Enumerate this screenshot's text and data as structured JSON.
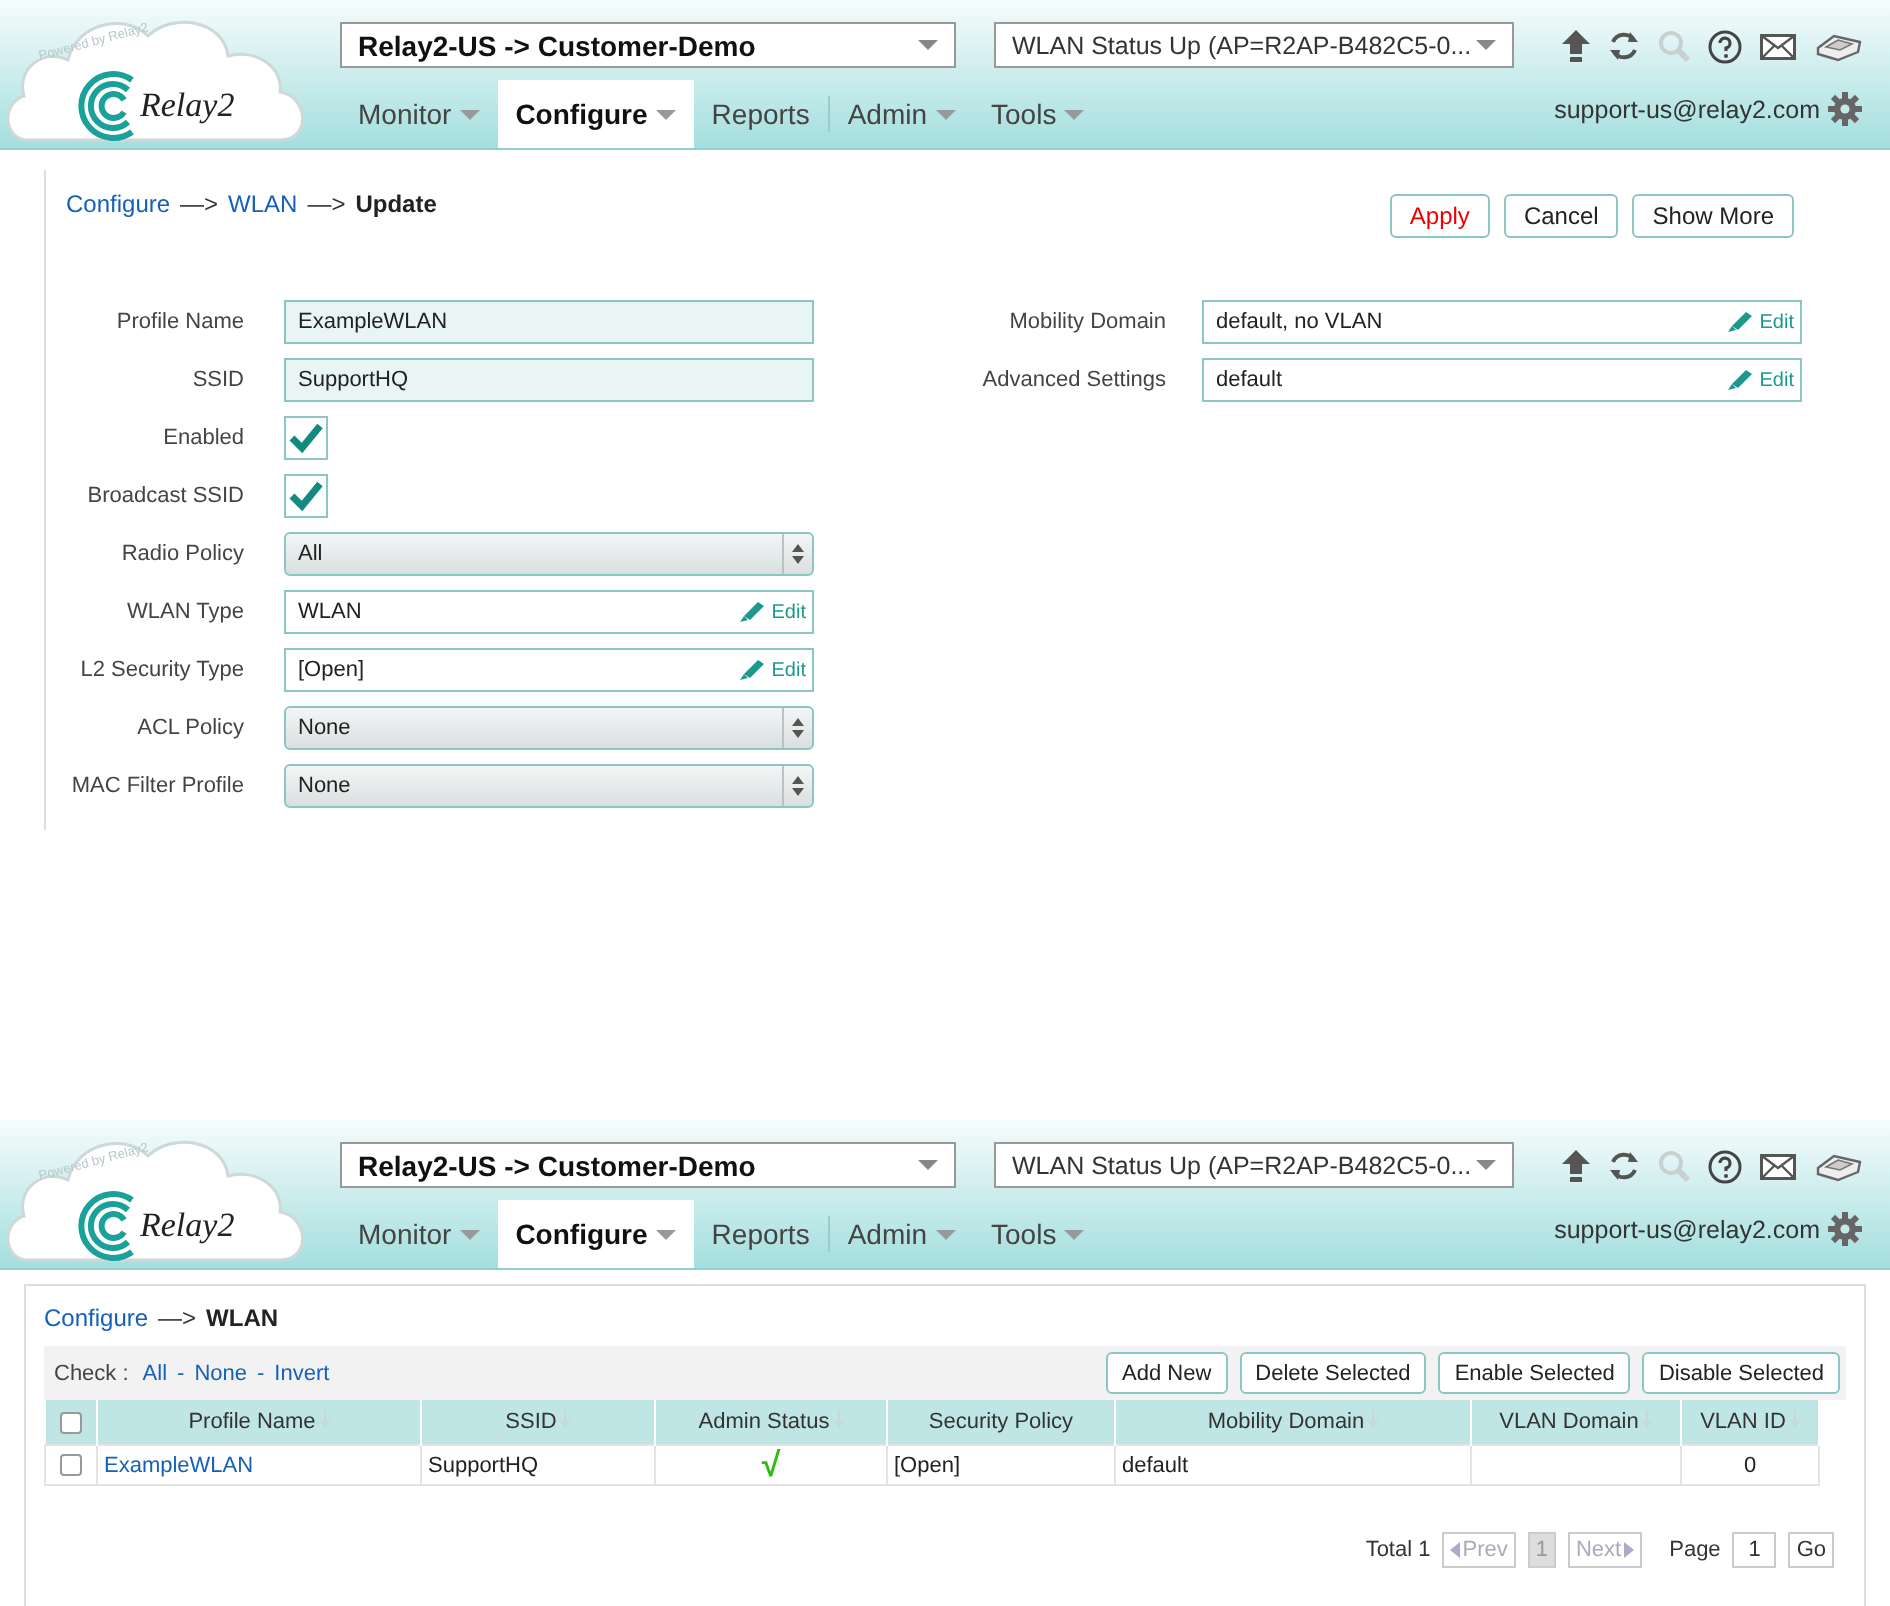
{
  "screens": [
    {
      "kind": "form",
      "header": {
        "logo_text": "Relay2",
        "logo_tagline": "Powered by Relay2",
        "org_select": "Relay2-US -> Customer-Demo",
        "status_select": "WLAN Status Up (AP=R2AP-B482C5-0...",
        "user": "support-us@relay2.com",
        "nav": [
          {
            "label": "Monitor",
            "selected": false,
            "dropdown": true
          },
          {
            "label": "Configure",
            "selected": true,
            "dropdown": true
          },
          {
            "label": "Reports",
            "selected": false,
            "dropdown": false
          },
          {
            "label": "Admin",
            "selected": false,
            "dropdown": true
          },
          {
            "label": "Tools",
            "selected": false,
            "dropdown": true
          }
        ]
      },
      "breadcrumb": {
        "separator": "—>",
        "items": [
          {
            "label": "Configure",
            "link": true
          },
          {
            "label": "WLAN",
            "link": true
          },
          {
            "label": "Update",
            "link": false
          }
        ]
      },
      "buttons": [
        {
          "label": "Apply",
          "kind": "primary"
        },
        {
          "label": "Cancel",
          "kind": "normal"
        },
        {
          "label": "Show More",
          "kind": "normal"
        }
      ],
      "left_fields": [
        {
          "label": "Profile Name",
          "kind": "readonly",
          "value": "ExampleWLAN"
        },
        {
          "label": "SSID",
          "kind": "readonly",
          "value": "SupportHQ"
        },
        {
          "label": "Enabled",
          "kind": "checkbox",
          "checked": true
        },
        {
          "label": "Broadcast SSID",
          "kind": "checkbox",
          "checked": true
        },
        {
          "label": "Radio Policy",
          "kind": "select",
          "value": "All"
        },
        {
          "label": "WLAN Type",
          "kind": "edit",
          "value": "WLAN",
          "edit_label": "Edit"
        },
        {
          "label": "L2 Security Type",
          "kind": "edit",
          "value": "[Open]",
          "edit_label": "Edit"
        },
        {
          "label": "ACL Policy",
          "kind": "select",
          "value": "None"
        },
        {
          "label": "MAC Filter Profile",
          "kind": "select",
          "value": "None"
        }
      ],
      "right_fields": [
        {
          "label": "Mobility Domain",
          "kind": "edit",
          "value": "default, no VLAN",
          "edit_label": "Edit"
        },
        {
          "label": "Advanced Settings",
          "kind": "edit",
          "value": "default",
          "edit_label": "Edit"
        }
      ]
    },
    {
      "kind": "list",
      "header": {
        "logo_text": "Relay2",
        "logo_tagline": "Powered by Relay2",
        "org_select": "Relay2-US -> Customer-Demo",
        "status_select": "WLAN Status Up (AP=R2AP-B482C5-0...",
        "user": "support-us@relay2.com",
        "nav": [
          {
            "label": "Monitor",
            "selected": false,
            "dropdown": true
          },
          {
            "label": "Configure",
            "selected": true,
            "dropdown": true
          },
          {
            "label": "Reports",
            "selected": false,
            "dropdown": false
          },
          {
            "label": "Admin",
            "selected": false,
            "dropdown": true
          },
          {
            "label": "Tools",
            "selected": false,
            "dropdown": true
          }
        ]
      },
      "breadcrumb": {
        "separator": "—>",
        "items": [
          {
            "label": "Configure",
            "link": true
          },
          {
            "label": "WLAN",
            "link": false
          }
        ]
      },
      "check": {
        "label": "Check :",
        "separator": "-",
        "links": [
          "All",
          "None",
          "Invert"
        ]
      },
      "buttons": [
        {
          "label": "Add New",
          "kind": "normal"
        },
        {
          "label": "Delete Selected",
          "kind": "normal"
        },
        {
          "label": "Enable Selected",
          "kind": "normal"
        },
        {
          "label": "Disable Selected",
          "kind": "normal"
        }
      ],
      "table": {
        "select_all_checked": false,
        "columns": [
          {
            "label": "Profile Name",
            "sortable": true
          },
          {
            "label": "SSID",
            "sortable": true
          },
          {
            "label": "Admin Status",
            "sortable": true
          },
          {
            "label": "Security Policy",
            "sortable": false
          },
          {
            "label": "Mobility Domain",
            "sortable": true
          },
          {
            "label": "VLAN Domain",
            "sortable": true
          },
          {
            "label": "VLAN ID",
            "sortable": true
          }
        ],
        "rows": [
          {
            "checked": false,
            "cells": [
              "ExampleWLAN",
              "SupportHQ",
              "√",
              "[Open]",
              "default",
              "",
              "0"
            ]
          }
        ]
      },
      "pagination": {
        "total": "Total 1",
        "prev": "Prev",
        "prev_disabled": true,
        "current": "1",
        "next": "Next",
        "next_disabled": true,
        "page_label": "Page",
        "page_value": "1",
        "go": "Go"
      }
    }
  ]
}
